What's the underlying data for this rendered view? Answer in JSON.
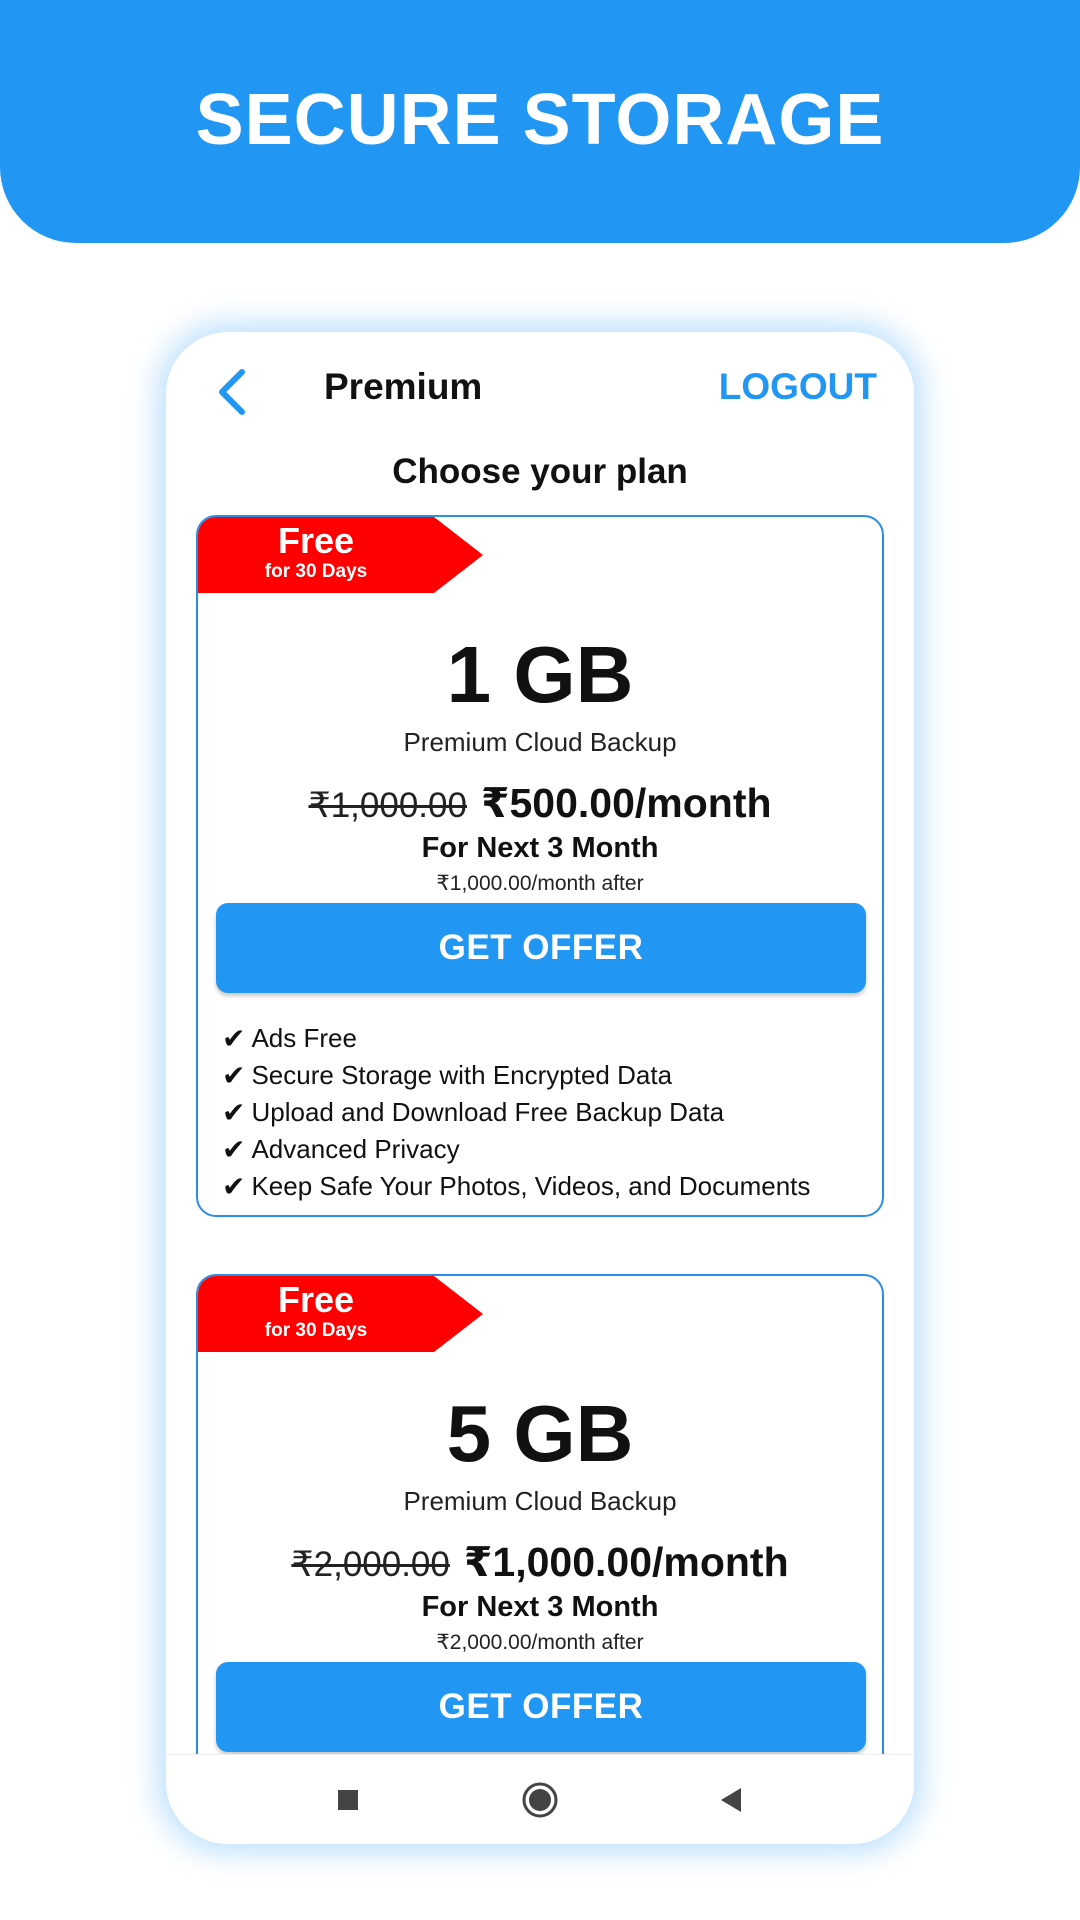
{
  "banner": {
    "title": "SECURE STORAGE"
  },
  "appbar": {
    "title": "Premium",
    "logout": "LOGOUT"
  },
  "heading": "Choose your plan",
  "plans": [
    {
      "ribbon_main": "Free",
      "ribbon_sub": "for 30 Days",
      "size": "1 GB",
      "subtitle": "Premium Cloud Backup",
      "old_price": "₹1,000.00",
      "new_price": "₹500.00/month",
      "term": "For Next 3 Month",
      "after": "₹1,000.00/month after",
      "button": "GET OFFER",
      "features": [
        "Ads Free",
        "Secure Storage with Encrypted Data",
        "Upload and Download Free Backup Data",
        "Advanced Privacy",
        "Keep Safe Your Photos, Videos, and Documents"
      ]
    },
    {
      "ribbon_main": "Free",
      "ribbon_sub": "for 30 Days",
      "size": "5 GB",
      "subtitle": "Premium Cloud Backup",
      "old_price": "₹2,000.00",
      "new_price": "₹1,000.00/month",
      "term": "For Next 3 Month",
      "after": "₹2,000.00/month after",
      "button": "GET OFFER"
    }
  ],
  "check_glyph": "✔",
  "colors": {
    "primary": "#2196f3",
    "ribbon": "#ff0000",
    "card_border": "#2a8ee5"
  },
  "icons": {
    "back": "chevron-left-icon",
    "nav": [
      "square-stop-icon",
      "home-circle-icon",
      "back-triangle-icon"
    ]
  }
}
